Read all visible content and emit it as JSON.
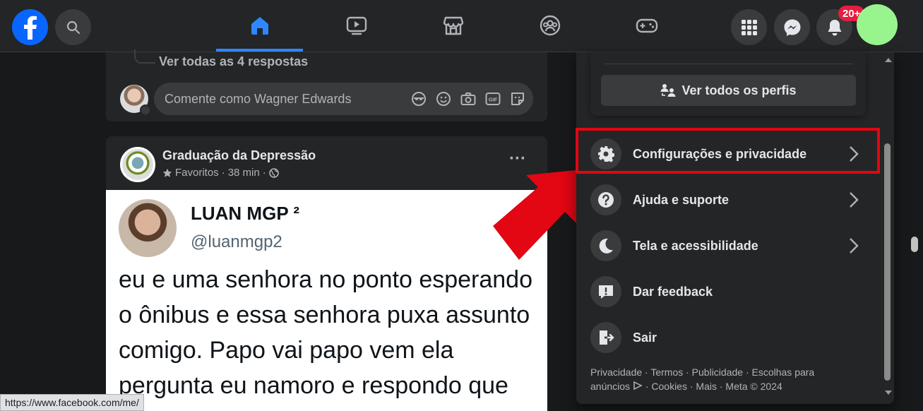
{
  "topbar": {
    "nav": [
      {
        "name": "home",
        "active": true
      },
      {
        "name": "watch",
        "active": false
      },
      {
        "name": "marketplace",
        "active": false
      },
      {
        "name": "groups",
        "active": false
      },
      {
        "name": "gaming",
        "active": false
      }
    ],
    "notification_badge": "20+",
    "accent_color": "#2d88ff",
    "badge_color": "#e41e3f"
  },
  "feed": {
    "replies_link": "Ver todas as 4 respostas",
    "comment_placeholder": "Comente como Wagner Edwards",
    "post": {
      "author": "Graduação da Depressão",
      "audience": "Favoritos",
      "time": "38 min",
      "more": "···"
    },
    "tweet": {
      "name": "LUAN MGP ²",
      "handle": "@luanmgp2",
      "text": "eu e uma senhora no ponto esperando o ônibus e essa senhora puxa assunto comigo. Papo vai papo vem ela pergunta eu namoro e respondo que"
    }
  },
  "menu": {
    "all_profiles": "Ver todos os perfis",
    "items": [
      {
        "label": "Configurações e privacidade",
        "icon": "gear-icon",
        "has_chevron": true,
        "highlighted": true
      },
      {
        "label": "Ajuda e suporte",
        "icon": "help-icon",
        "has_chevron": true
      },
      {
        "label": "Tela e acessibilidade",
        "icon": "moon-icon",
        "has_chevron": true
      },
      {
        "label": "Dar feedback",
        "icon": "feedback-icon",
        "has_chevron": false
      },
      {
        "label": "Sair",
        "icon": "logout-icon",
        "has_chevron": false
      }
    ],
    "footer_line1": "Privacidade · Termos · Publicidade · Escolhas para",
    "footer_line2_a": "anúncios",
    "footer_line2_b": "· Cookies · Mais · Meta © 2024",
    "highlight_color": "#e30613"
  },
  "status_url": "https://www.facebook.com/me/"
}
